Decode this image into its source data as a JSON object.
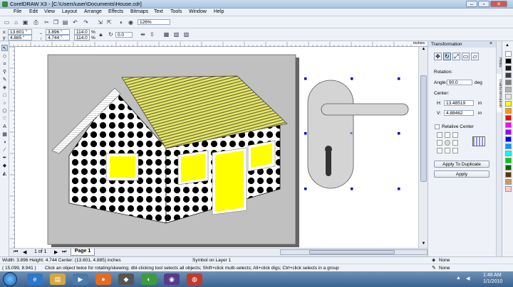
{
  "window": {
    "title": "CorelDRAW X3 - [C:\\Users\\user\\Documents\\House.cdr]",
    "minimize": "–",
    "restore": "▫",
    "close": "✕"
  },
  "menu": [
    "File",
    "Edit",
    "View",
    "Layout",
    "Arrange",
    "Effects",
    "Bitmaps",
    "Text",
    "Tools",
    "Window",
    "Help"
  ],
  "toolbar": {
    "zoom": "126%"
  },
  "property_bar": {
    "x_label": "x:",
    "x_value": "13.601 \"",
    "y_label": "y:",
    "y_value": "4.885 \"",
    "w_value": "3.896 \"",
    "h_value": "4.744 \"",
    "scale_w": "114.0",
    "scale_h": "114.0",
    "scale_unit": "%",
    "rotation": "0.0"
  },
  "ruler_unit": "inches",
  "page_nav": {
    "counter": "1 of 1",
    "page_tab": "Page 1"
  },
  "docker": {
    "header": "Transformation",
    "rotation_label": "Rotation:",
    "angle_label": "Angle:",
    "angle_value": "90.0",
    "angle_unit": "deg",
    "center_label": "Center:",
    "h_label": "H:",
    "h_value": "13.48519",
    "h_unit": "in",
    "v_label": "V:",
    "v_value": "4.88462",
    "v_unit": "in",
    "relative_center": "Relative Center",
    "apply_dup": "Apply To Duplicate",
    "apply": "Apply"
  },
  "docker_tabs": [
    "Hints",
    "Transformation"
  ],
  "palette": [
    "#ffffff",
    "#000000",
    "#1a1a1a",
    "#3d3d3d",
    "#7f7f7f",
    "#b3b3b3",
    "#e6e6e6",
    "#ffff00",
    "#ff9900",
    "#ff0000",
    "#ff00ff",
    "#9900ff",
    "#0000ff",
    "#0099ff",
    "#00ffff",
    "#00cc00",
    "#006600",
    "#663300",
    "#cc9966",
    "#ffcccc"
  ],
  "status": {
    "dimensions": "Width: 3.896  Height: 4.744  Center: (13.601, 4.885)  inches",
    "layer": "Symbol on Layer 1",
    "coords": "( 15.099, 8.941 )",
    "hint": "Click an object twice for rotating/skewing; dbl-clicking tool selects all objects; Shift+click multi-selects; Alt+click digs; Ctrl+click selects in a group",
    "fill": "None",
    "outline": "None"
  },
  "taskbar": {
    "time": "1:48 AM",
    "date": "1/1/2010"
  },
  "colors": {
    "house_wall_dots": "#000000",
    "roof": "#e6e86a",
    "window_fill": "#ffff00",
    "page_shadow": "#666666",
    "desktop_bg": "#c0c0c0",
    "handle": "#d4d4d4",
    "selection": "#0000c8"
  }
}
